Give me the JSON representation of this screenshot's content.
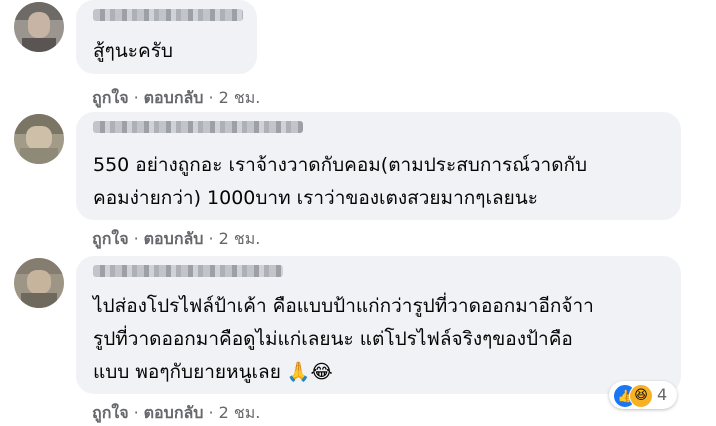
{
  "comments": [
    {
      "lines": [
        "สู้ๆนะครับ"
      ],
      "actions": {
        "like": "ถูกใจ",
        "reply": "ตอบกลับ",
        "time": "2 ชม."
      }
    },
    {
      "lines": [
        "550 อย่างถูกอะ เราจ้างวาดกับคอม(ตามประสบการณ์วาดกับ",
        "คอมง่ายกว่า) 1000บาท เราว่าของเตงสวยมากๆเลยนะ"
      ],
      "actions": {
        "like": "ถูกใจ",
        "reply": "ตอบกลับ",
        "time": "2 ชม."
      }
    },
    {
      "lines": [
        "ไปส่องโปรไฟล์ป้าเค้า คือแบบป้าแก่กว่ารูปที่วาดออกมาอีกจ้าา",
        "รูปที่วาดออกมาคือดูไม่แก่เลยนะ แต่โปรไฟล์จริงๆของป้าคือ",
        "แบบ พอๆกับยายหนูเลย 🙏😂"
      ],
      "actions": {
        "like": "ถูกใจ",
        "reply": "ตอบกลับ",
        "time": "2 ชม."
      },
      "reactions": {
        "icons": [
          "like-icon",
          "haha-icon"
        ],
        "count": "4"
      }
    }
  ],
  "separator": "·",
  "colors": {
    "bubble": "#f0f2f5",
    "meta": "#65676b",
    "like": "#1877f2",
    "haha": "#f7b125"
  }
}
